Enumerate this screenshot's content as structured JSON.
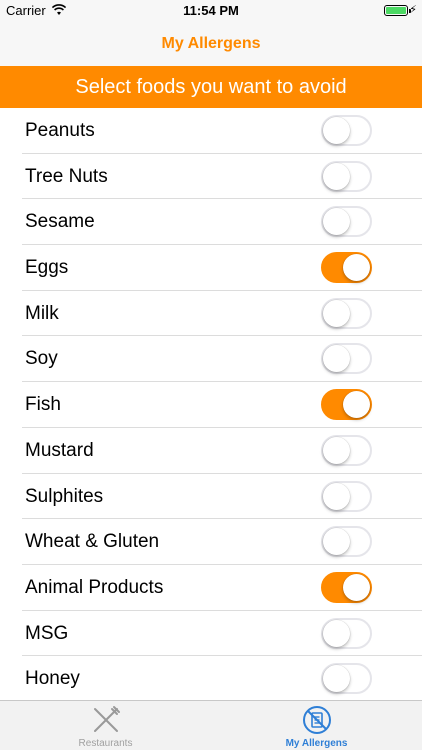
{
  "status_bar": {
    "carrier": "Carrier",
    "time": "11:54 PM"
  },
  "nav": {
    "title": "My Allergens"
  },
  "banner": {
    "text": "Select foods you want to avoid"
  },
  "allergens": [
    {
      "label": "Peanuts",
      "enabled": false
    },
    {
      "label": "Tree Nuts",
      "enabled": false
    },
    {
      "label": "Sesame",
      "enabled": false
    },
    {
      "label": "Eggs",
      "enabled": true
    },
    {
      "label": "Milk",
      "enabled": false
    },
    {
      "label": "Soy",
      "enabled": false
    },
    {
      "label": "Fish",
      "enabled": true
    },
    {
      "label": "Mustard",
      "enabled": false
    },
    {
      "label": "Sulphites",
      "enabled": false
    },
    {
      "label": "Wheat & Gluten",
      "enabled": false
    },
    {
      "label": "Animal Products",
      "enabled": true
    },
    {
      "label": "MSG",
      "enabled": false
    },
    {
      "label": "Honey",
      "enabled": false
    }
  ],
  "tabs": [
    {
      "label": "Restaurants",
      "icon": "fork-knife-icon",
      "selected": false
    },
    {
      "label": "My Allergens",
      "icon": "allergen-list-icon",
      "selected": true
    }
  ],
  "colors": {
    "accent": "#ff8a00",
    "tab_selected": "#2f7fd6",
    "tab_unselected": "#a0a0a0"
  }
}
